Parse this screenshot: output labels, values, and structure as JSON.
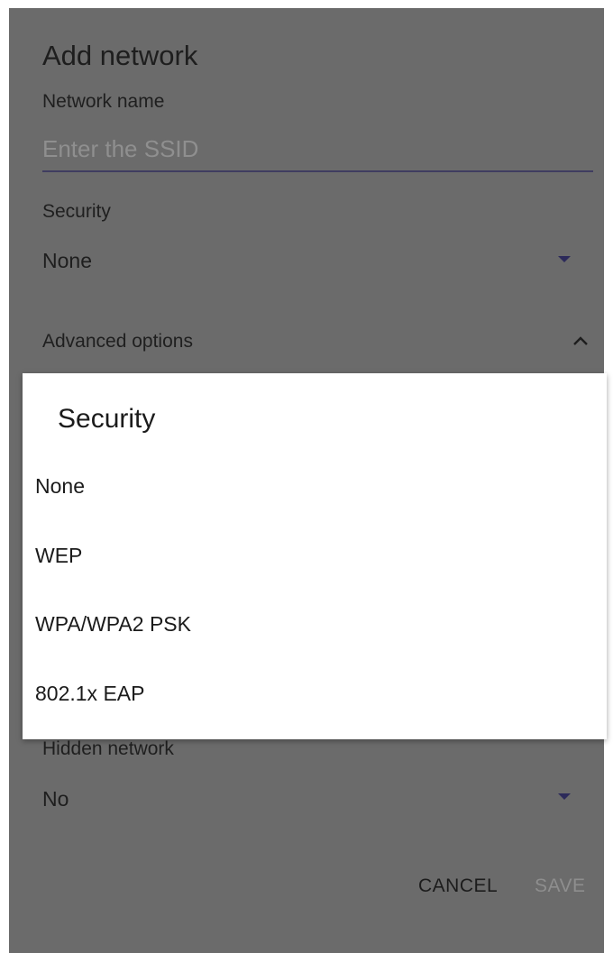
{
  "add_network": {
    "title": "Add network",
    "network_name_label": "Network name",
    "ssid_placeholder": "Enter the SSID",
    "ssid_value": "",
    "security_label": "Security",
    "security_value": "None",
    "advanced_label": "Advanced options",
    "hidden_label": "Hidden network",
    "hidden_value": "No",
    "cancel_label": "CANCEL",
    "save_label": "SAVE"
  },
  "security_picker": {
    "title": "Security",
    "options": [
      {
        "label": "None"
      },
      {
        "label": "WEP"
      },
      {
        "label": "WPA/WPA2 PSK"
      },
      {
        "label": "802.1x EAP"
      }
    ]
  },
  "colors": {
    "scrim_dialog": "#6b6b6b",
    "accent": "#2c2a5a",
    "picker_background": "#ffffff"
  },
  "icons": {
    "security_dropdown": "caret-down-icon",
    "advanced_toggle": "chevron-up-icon",
    "hidden_dropdown": "caret-down-icon"
  }
}
